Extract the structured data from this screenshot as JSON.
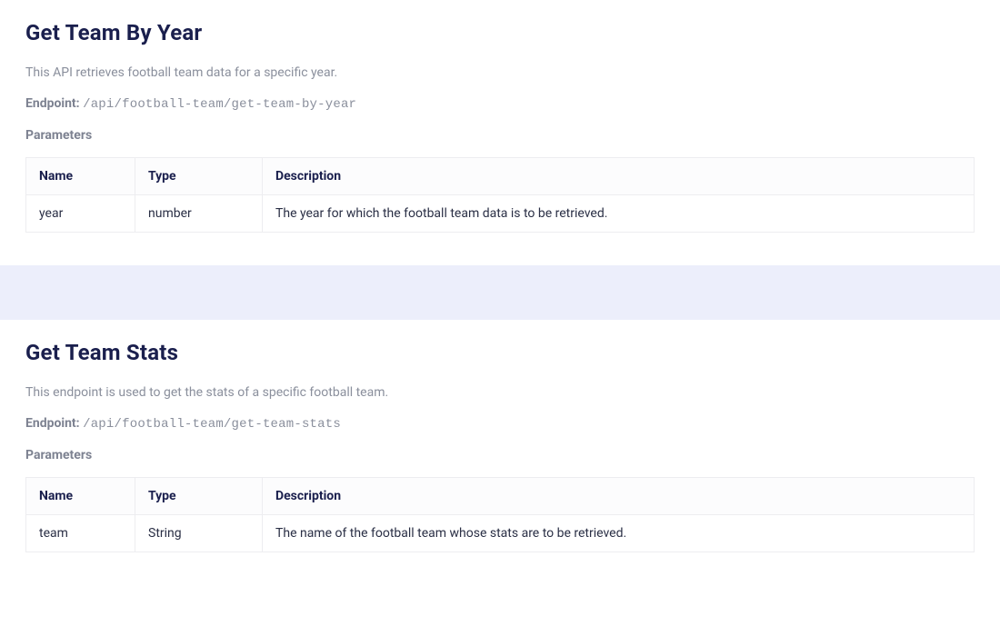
{
  "sections": [
    {
      "title": "Get Team By Year",
      "description": "This API retrieves football team data for a specific year.",
      "endpoint_label": "Endpoint:",
      "endpoint_path": "/api/football-team/get-team-by-year",
      "parameters_label": "Parameters",
      "table": {
        "headers": {
          "name": "Name",
          "type": "Type",
          "description": "Description"
        },
        "rows": [
          {
            "name": "year",
            "type": "number",
            "description": "The year for which the football team data is to be retrieved."
          }
        ]
      }
    },
    {
      "title": "Get Team Stats",
      "description": "This endpoint is used to get the stats of a specific football team.",
      "endpoint_label": "Endpoint:",
      "endpoint_path": "/api/football-team/get-team-stats",
      "parameters_label": "Parameters",
      "table": {
        "headers": {
          "name": "Name",
          "type": "Type",
          "description": "Description"
        },
        "rows": [
          {
            "name": "team",
            "type": "String",
            "description": "The name of the football team whose stats are to be retrieved."
          }
        ]
      }
    }
  ]
}
